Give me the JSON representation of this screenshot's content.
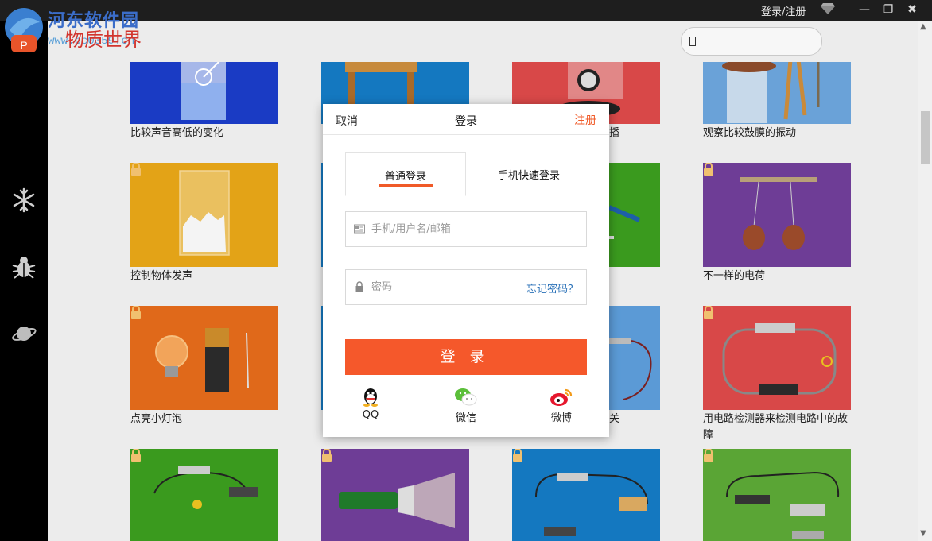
{
  "titlebar": {
    "login_register": "登录/注册",
    "minimize": "—",
    "restore": "❐",
    "close": "✖"
  },
  "watermark": {
    "site": "河东软件园",
    "url": "www.pc0359.cn"
  },
  "app": {
    "name": "物质世界"
  },
  "search": {
    "value": "",
    "placeholder": ""
  },
  "sidebar": {
    "icons": [
      "snowflake-icon",
      "bug-icon",
      "planet-icon"
    ]
  },
  "cards": [
    {
      "title": "比较声音高低的变化",
      "bg": "#1a3bc4",
      "locked": false
    },
    {
      "title": "",
      "bg": "#1478c0",
      "locked": false
    },
    {
      "title": "播",
      "bg": "#d84848",
      "locked": false
    },
    {
      "title": "观察比较鼓膜的振动",
      "bg": "#6aa2d8",
      "locked": false
    },
    {
      "title": "控制物体发声",
      "bg": "#e3a317",
      "locked": true
    },
    {
      "title": "",
      "bg": "#1478c0",
      "locked": false
    },
    {
      "title": "",
      "bg": "#3a9a1e",
      "locked": true
    },
    {
      "title": "不一样的电荷",
      "bg": "#6e3d96",
      "locked": true
    },
    {
      "title": "点亮小灯泡",
      "bg": "#e0691a",
      "locked": true
    },
    {
      "title": "",
      "bg": "#1478c0",
      "locked": false
    },
    {
      "title": "关",
      "bg": "#5b9ad6",
      "locked": true
    },
    {
      "title": "用电路检测器来检测电路中的故障",
      "bg": "#d84848",
      "locked": true
    },
    {
      "title": "",
      "bg": "#3a9a1e",
      "locked": true
    },
    {
      "title": "",
      "bg": "#6e3d96",
      "locked": true
    },
    {
      "title": "",
      "bg": "#1478c0",
      "locked": true
    },
    {
      "title": "",
      "bg": "#5aa535",
      "locked": true
    }
  ],
  "modal": {
    "cancel": "取消",
    "title": "登录",
    "register": "注册",
    "tab_normal": "普通登录",
    "tab_phone": "手机快速登录",
    "username_placeholder": "手机/用户名/邮箱",
    "password_placeholder": "密码",
    "forgot": "忘记密码？",
    "login_button": "登录",
    "social": [
      {
        "label": "QQ",
        "icon": "qq-icon"
      },
      {
        "label": "微信",
        "icon": "wechat-icon"
      },
      {
        "label": "微博",
        "icon": "weibo-icon"
      }
    ]
  },
  "colors": {
    "accent": "#f5582b",
    "link": "#2b72b8"
  }
}
